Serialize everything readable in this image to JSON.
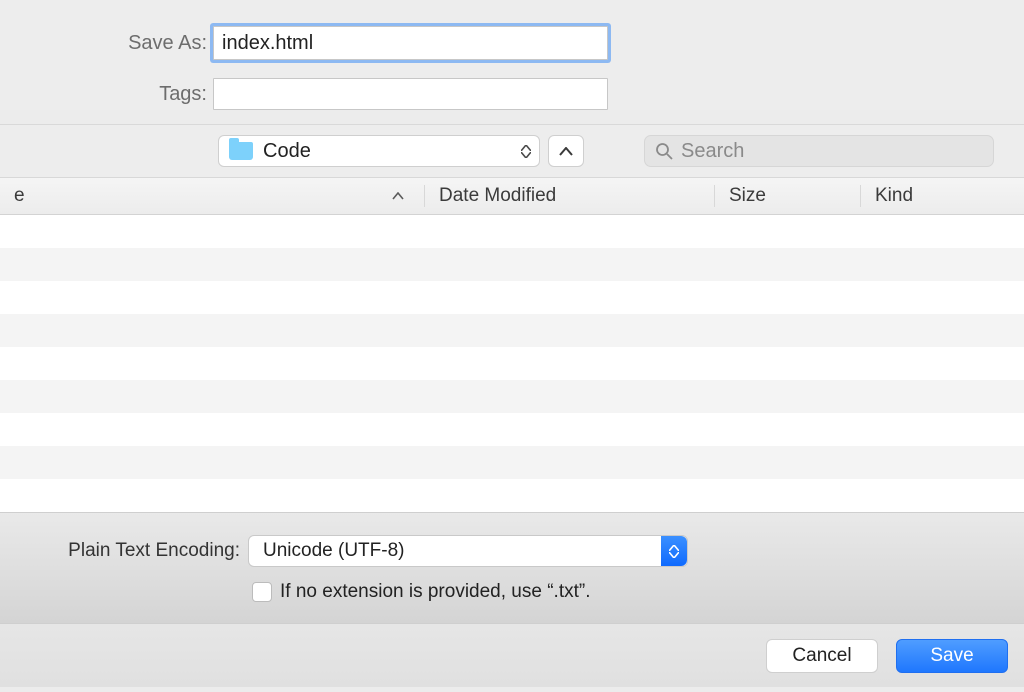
{
  "form": {
    "save_as_label": "Save As:",
    "save_as_value": "index.html",
    "tags_label": "Tags:",
    "tags_value": ""
  },
  "location": {
    "folder_name": "Code",
    "search_placeholder": "Search"
  },
  "columns": {
    "name": "e",
    "date_modified": "Date Modified",
    "size": "Size",
    "kind": "Kind"
  },
  "options": {
    "encoding_label": "Plain Text Encoding:",
    "encoding_value": "Unicode (UTF-8)",
    "extension_checkbox_label": "If no extension is provided, use “.txt”.",
    "extension_checkbox_checked": false
  },
  "actions": {
    "cancel": "Cancel",
    "save": "Save"
  }
}
